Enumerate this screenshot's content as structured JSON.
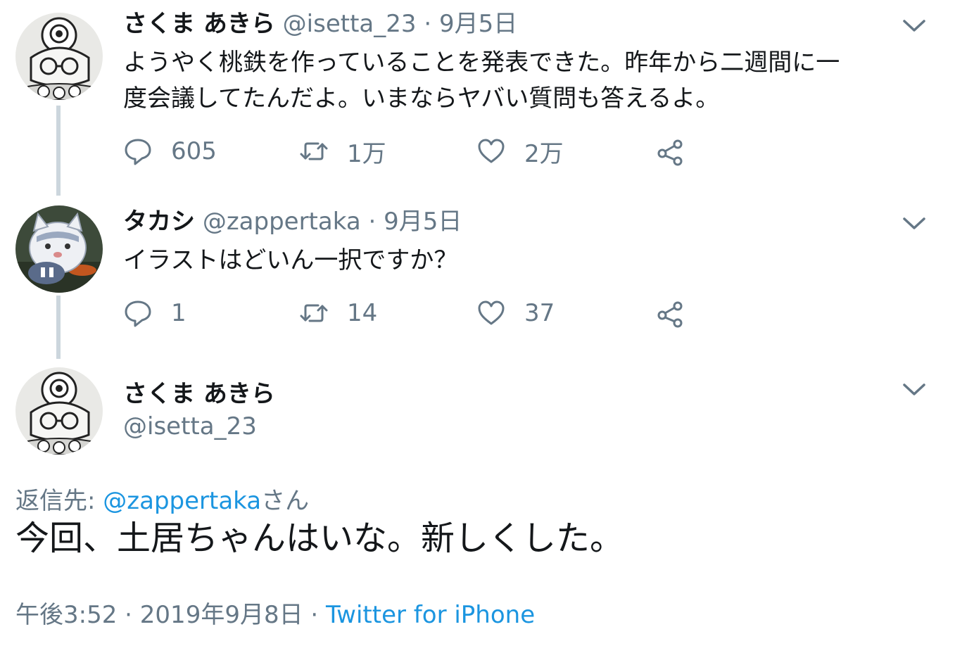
{
  "tweets": [
    {
      "name": "さくま あきら",
      "handle": "@isetta_23",
      "sep": "·",
      "date": "9月5日",
      "text_lines": [
        "ようやく桃鉄を作っていることを発表できた。昨年から二週間に一",
        "度会議してたんだよ。いまならヤバい質問も答えるよ。"
      ],
      "replies": "605",
      "retweets": "1万",
      "likes": "2万"
    },
    {
      "name": "タカシ",
      "handle": "@zappertaka",
      "sep": "·",
      "date": "9月5日",
      "text_lines": [
        "イラストはどいん一択ですか？"
      ],
      "replies": "1",
      "retweets": "14",
      "likes": "37"
    }
  ],
  "focused": {
    "name": "さくま あきら",
    "handle": "@isetta_23",
    "reply_prefix": "返信先: ",
    "reply_mention": "@zappertaka",
    "reply_suffix": "さん",
    "text": "今回、土居ちゃんはいな。新しくした。",
    "time": "午後3:52",
    "sep1": "·",
    "date": "2019年9月8日",
    "sep2": "·",
    "source": "Twitter for iPhone"
  },
  "icons": {
    "reply": "reply-icon",
    "retweet": "retweet-icon",
    "like": "heart-icon",
    "share": "share-icon",
    "caret": "chevron-down-icon"
  },
  "colors": {
    "text": "#14171a",
    "secondary": "#657786",
    "link": "#1b95e0",
    "thread_line": "#ccd6dd"
  }
}
